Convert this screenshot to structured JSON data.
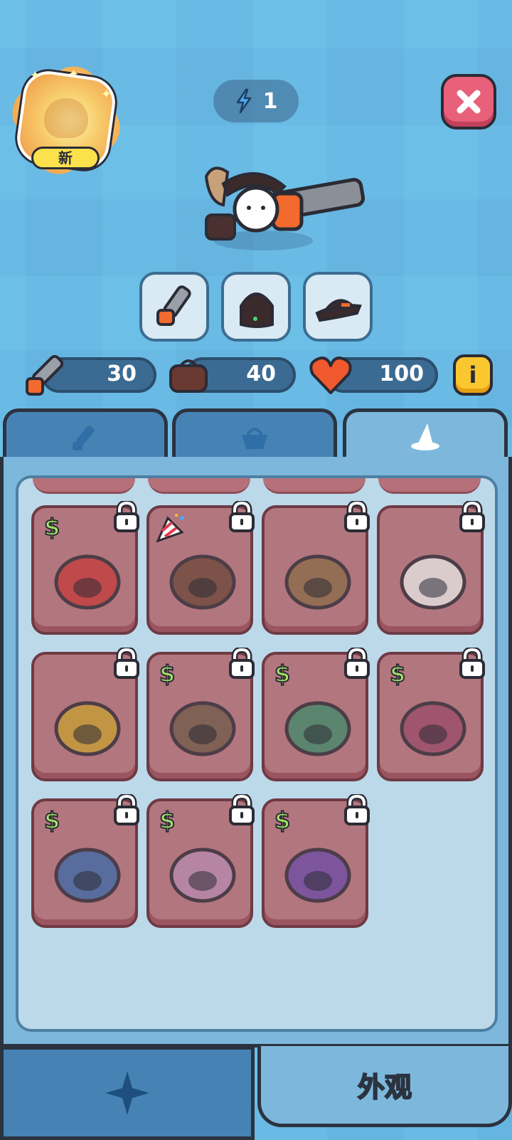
{
  "header": {
    "new_badge_label": "新",
    "energy_count": "1",
    "close_icon": "close-icon"
  },
  "equipment_slots": [
    {
      "icon": "chainsaw-icon"
    },
    {
      "icon": "backpack-icon"
    },
    {
      "icon": "hat-icon"
    }
  ],
  "stats": {
    "weapon": {
      "icon": "chainsaw-icon",
      "value": "30"
    },
    "bag": {
      "icon": "backpack-icon",
      "value": "40"
    },
    "health": {
      "icon": "heart-icon",
      "value": "100"
    },
    "info_label": "i"
  },
  "tabs": [
    {
      "icon": "chainsaw-icon",
      "active": false
    },
    {
      "icon": "basket-icon",
      "active": false
    },
    {
      "icon": "wizard-hat-icon",
      "active": true
    }
  ],
  "cards": [
    {
      "art": "santa-hat-icon",
      "badge": "$",
      "locked": true
    },
    {
      "art": "reindeer-hood-icon",
      "badge": "party-popper",
      "locked": true
    },
    {
      "art": "capybara-hood-icon",
      "badge": "",
      "locked": true
    },
    {
      "art": "cow-hood-icon",
      "badge": "",
      "locked": true
    },
    {
      "art": "monkey-hat-icon",
      "badge": "",
      "locked": true
    },
    {
      "art": "cricket-helmet-icon",
      "badge": "$",
      "locked": true
    },
    {
      "art": "green-hood-icon",
      "badge": "$",
      "locked": true
    },
    {
      "art": "jester-hat-icon",
      "badge": "$",
      "locked": true
    },
    {
      "art": "circus-hat-icon",
      "badge": "$",
      "locked": true
    },
    {
      "art": "bunny-hood-icon",
      "badge": "$",
      "locked": true
    },
    {
      "art": "witch-hat-icon",
      "badge": "$",
      "locked": true
    }
  ],
  "bottom_nav": {
    "left_icon": "star-icon",
    "right_label": "外观"
  },
  "colors": {
    "background": "#6cc0e8",
    "card": "#b2767e",
    "dollar": "#a6e36a",
    "close": "#e8607a"
  }
}
